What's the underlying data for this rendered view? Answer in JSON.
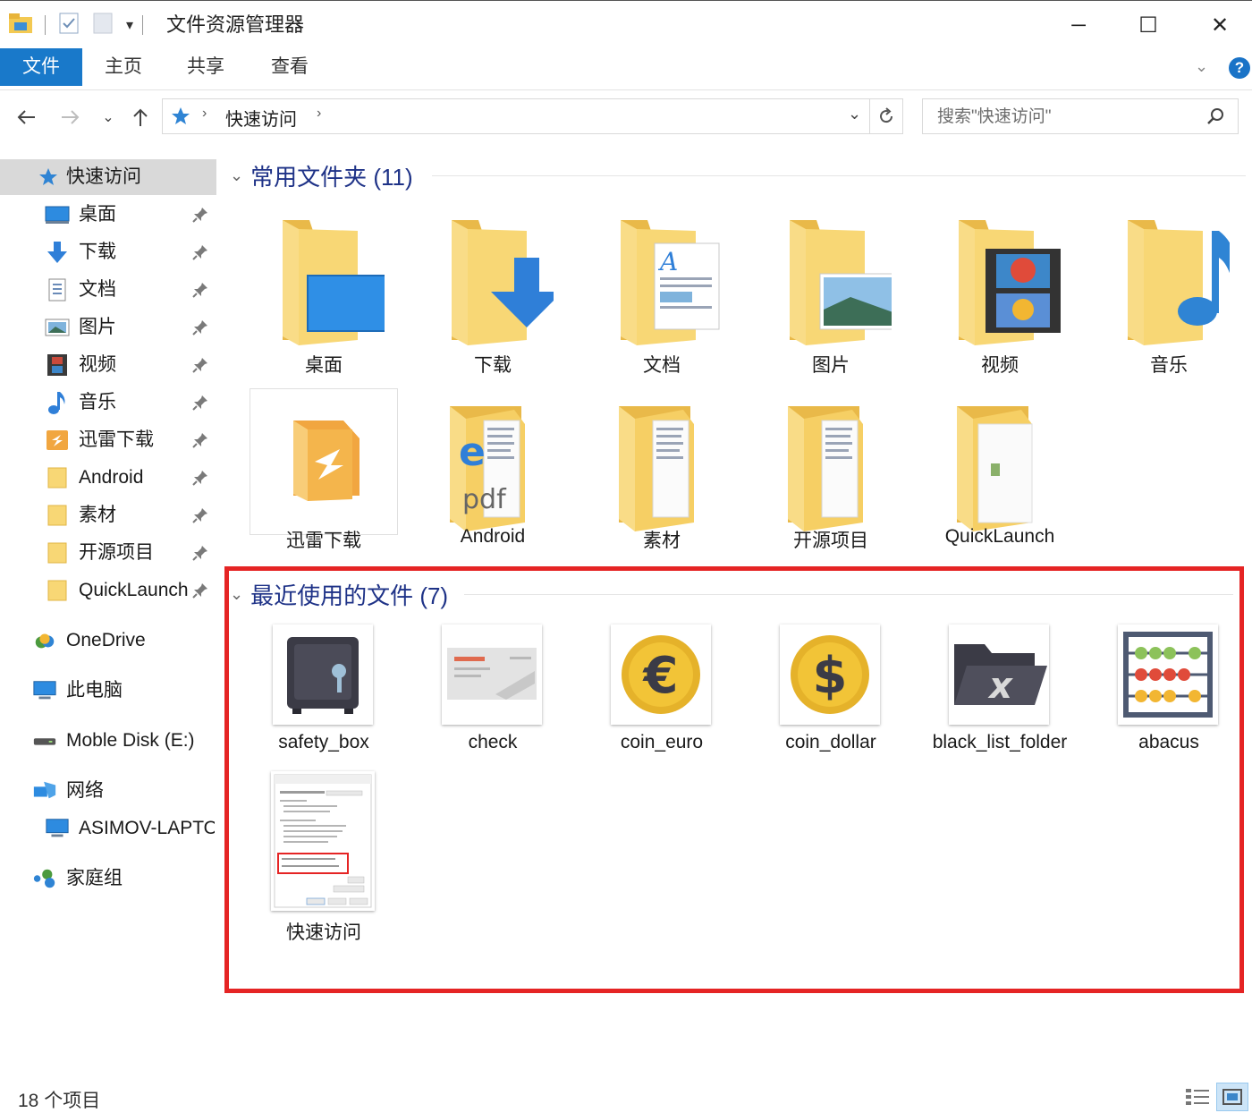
{
  "window": {
    "title": "文件资源管理器",
    "minimize_glyph": "─",
    "maximize_glyph": "☐",
    "close_glyph": "✕"
  },
  "ribbon": {
    "tabs": [
      {
        "label": "文件"
      },
      {
        "label": "主页"
      },
      {
        "label": "共享"
      },
      {
        "label": "查看"
      }
    ],
    "help_glyph": "?"
  },
  "address": {
    "path_root": "快速访问",
    "search_placeholder": "搜索\"快速访问\""
  },
  "sidebar": {
    "quick_access": "快速访问",
    "items": [
      {
        "label": "桌面",
        "icon": "desktop-icon"
      },
      {
        "label": "下载",
        "icon": "download-icon"
      },
      {
        "label": "文档",
        "icon": "document-icon"
      },
      {
        "label": "图片",
        "icon": "picture-icon"
      },
      {
        "label": "视频",
        "icon": "video-icon"
      },
      {
        "label": "音乐",
        "icon": "music-icon"
      },
      {
        "label": "迅雷下载",
        "icon": "thunder-icon"
      },
      {
        "label": "Android",
        "icon": "folder-icon"
      },
      {
        "label": "素材",
        "icon": "folder-icon"
      },
      {
        "label": "开源项目",
        "icon": "folder-icon"
      },
      {
        "label": "QuickLaunch",
        "icon": "folder-icon"
      }
    ],
    "onedrive": "OneDrive",
    "this_pc": "此电脑",
    "mobile_disk": "Moble Disk (E:)",
    "network": "网络",
    "network_pc": "ASIMOV-LAPTOP",
    "homegroup": "家庭组"
  },
  "groups": {
    "frequent": {
      "title": "常用文件夹 (11)",
      "items": [
        {
          "label": "桌面"
        },
        {
          "label": "下载"
        },
        {
          "label": "文档"
        },
        {
          "label": "图片"
        },
        {
          "label": "视频"
        },
        {
          "label": "音乐"
        },
        {
          "label": "迅雷下载"
        },
        {
          "label": "Android"
        },
        {
          "label": "素材"
        },
        {
          "label": "开源项目"
        },
        {
          "label": "QuickLaunch"
        }
      ]
    },
    "recent": {
      "title": "最近使用的文件 (7)",
      "items": [
        {
          "label": "safety_box"
        },
        {
          "label": "check"
        },
        {
          "label": "coin_euro"
        },
        {
          "label": "coin_dollar"
        },
        {
          "label": "black_list_folder"
        },
        {
          "label": "abacus"
        },
        {
          "label": "快速访问"
        }
      ]
    }
  },
  "status": {
    "item_count": "18 个项目"
  },
  "colors": {
    "accent": "#1979ca",
    "folder": "#f8d775",
    "header_text": "#1e3287",
    "highlight": "#e52424"
  }
}
